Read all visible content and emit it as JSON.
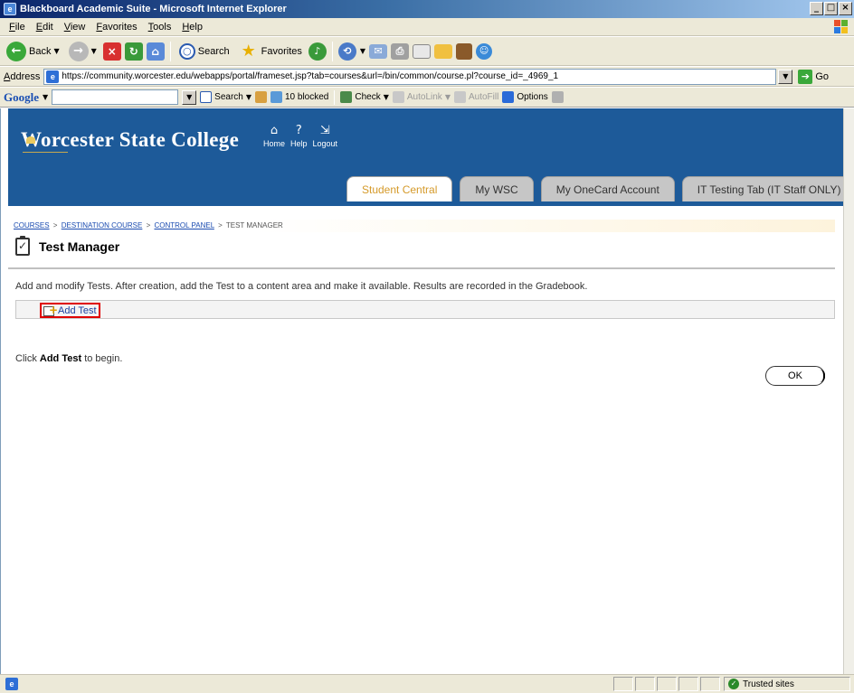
{
  "window": {
    "title": "Blackboard Academic Suite - Microsoft Internet Explorer",
    "controls": {
      "minimize": "_",
      "maximize": "□",
      "close": "×"
    }
  },
  "menubar": [
    "File",
    "Edit",
    "View",
    "Favorites",
    "Tools",
    "Help"
  ],
  "toolbar": {
    "back_label": "Back",
    "search_label": "Search",
    "favorites_label": "Favorites"
  },
  "address": {
    "label": "Address",
    "url": "https://community.worcester.edu/webapps/portal/frameset.jsp?tab=courses&url=/bin/common/course.pl?course_id=_4969_1",
    "go_label": "Go"
  },
  "google_toolbar": {
    "logo": "Google",
    "search_label": "Search",
    "blocked_label": "10 blocked",
    "check_label": "Check",
    "autolink_label": "AutoLink",
    "autofill_label": "AutoFill",
    "options_label": "Options"
  },
  "site": {
    "logo_text": "Worcester State College",
    "nav": [
      {
        "label": "Home",
        "icon": "home-icon"
      },
      {
        "label": "Help",
        "icon": "help-icon"
      },
      {
        "label": "Logout",
        "icon": "logout-icon"
      }
    ],
    "tabs": [
      {
        "label": "Student Central",
        "active": true
      },
      {
        "label": "My WSC",
        "active": false
      },
      {
        "label": "My OneCard Account",
        "active": false
      },
      {
        "label": "IT Testing Tab (IT Staff ONLY)",
        "active": false
      }
    ]
  },
  "breadcrumb": {
    "items": [
      "COURSES",
      "DESTINATION COURSE",
      "CONTROL PANEL"
    ],
    "current": "TEST MANAGER",
    "separator": ">"
  },
  "page": {
    "title": "Test Manager",
    "description": "Add and modify Tests. After creation, add the Test to a content area and make it available. Results are recorded in the Gradebook.",
    "add_test_label": "Add Test",
    "hint_prefix": "Click ",
    "hint_bold": "Add Test",
    "hint_suffix": " to begin.",
    "ok_label": "OK"
  },
  "statusbar": {
    "zone_label": "Trusted sites"
  },
  "colors": {
    "header_blue": "#1d5a99",
    "active_tab_text": "#d59a2a",
    "highlight_red": "#e00000",
    "link_blue": "#1a4bb0"
  }
}
